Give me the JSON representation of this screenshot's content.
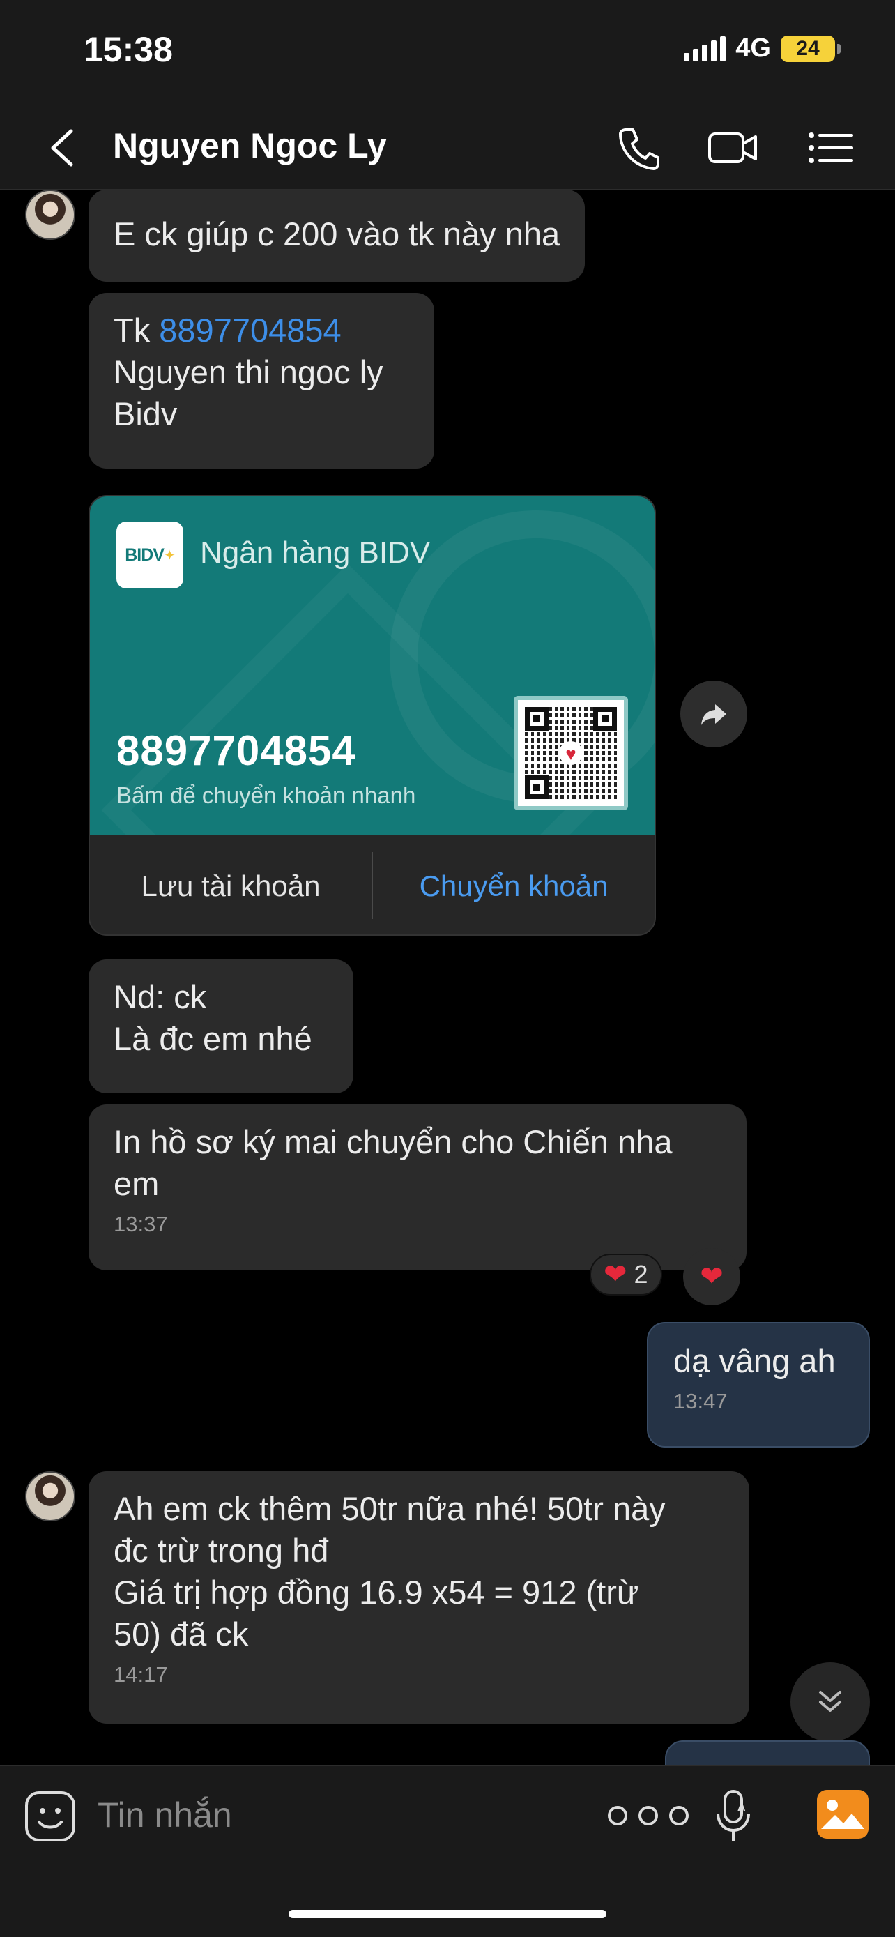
{
  "status_bar": {
    "time": "15:38",
    "network": "4G",
    "battery": "24"
  },
  "header": {
    "contact_name": "Nguyen Ngoc Ly"
  },
  "messages": {
    "m1": "E ck giúp c 200 vào tk này nha",
    "m2": {
      "prefix": "Tk ",
      "account_link": "8897704854",
      "line2": "Nguyen thi ngoc ly",
      "line3": "Bidv"
    },
    "bank_card": {
      "logo_text": "BIDV",
      "bank_name": "Ngân hàng BIDV",
      "account_number": "8897704854",
      "hint": "Bấm để chuyển khoản nhanh",
      "save_label": "Lưu tài khoản",
      "transfer_label": "Chuyển khoản"
    },
    "m4": {
      "line1": "Nd: ck",
      "line2": "Là đc em nhé"
    },
    "m5": {
      "line1": "In hồ sơ ký mai chuyển cho Chiến nha",
      "line2": "em",
      "time": "13:37",
      "reaction_count": "2"
    },
    "m6": {
      "text": "dạ vâng ah",
      "time": "13:47"
    },
    "m7": {
      "line1": "Ah em ck thêm 50tr nữa nhé! 50tr này",
      "line2": "đc trừ trong hđ",
      "line3": "Giá trị hợp đồng 16.9 x54 = 912 (trừ",
      "line4": "50) đã ck",
      "time": "14:17"
    }
  },
  "composer": {
    "placeholder": "Tin nhắn"
  },
  "colors": {
    "card_teal": "#137a78",
    "link_blue": "#3d8ee8",
    "heart_red": "#e6283b",
    "gallery_orange": "#f28c1c"
  }
}
